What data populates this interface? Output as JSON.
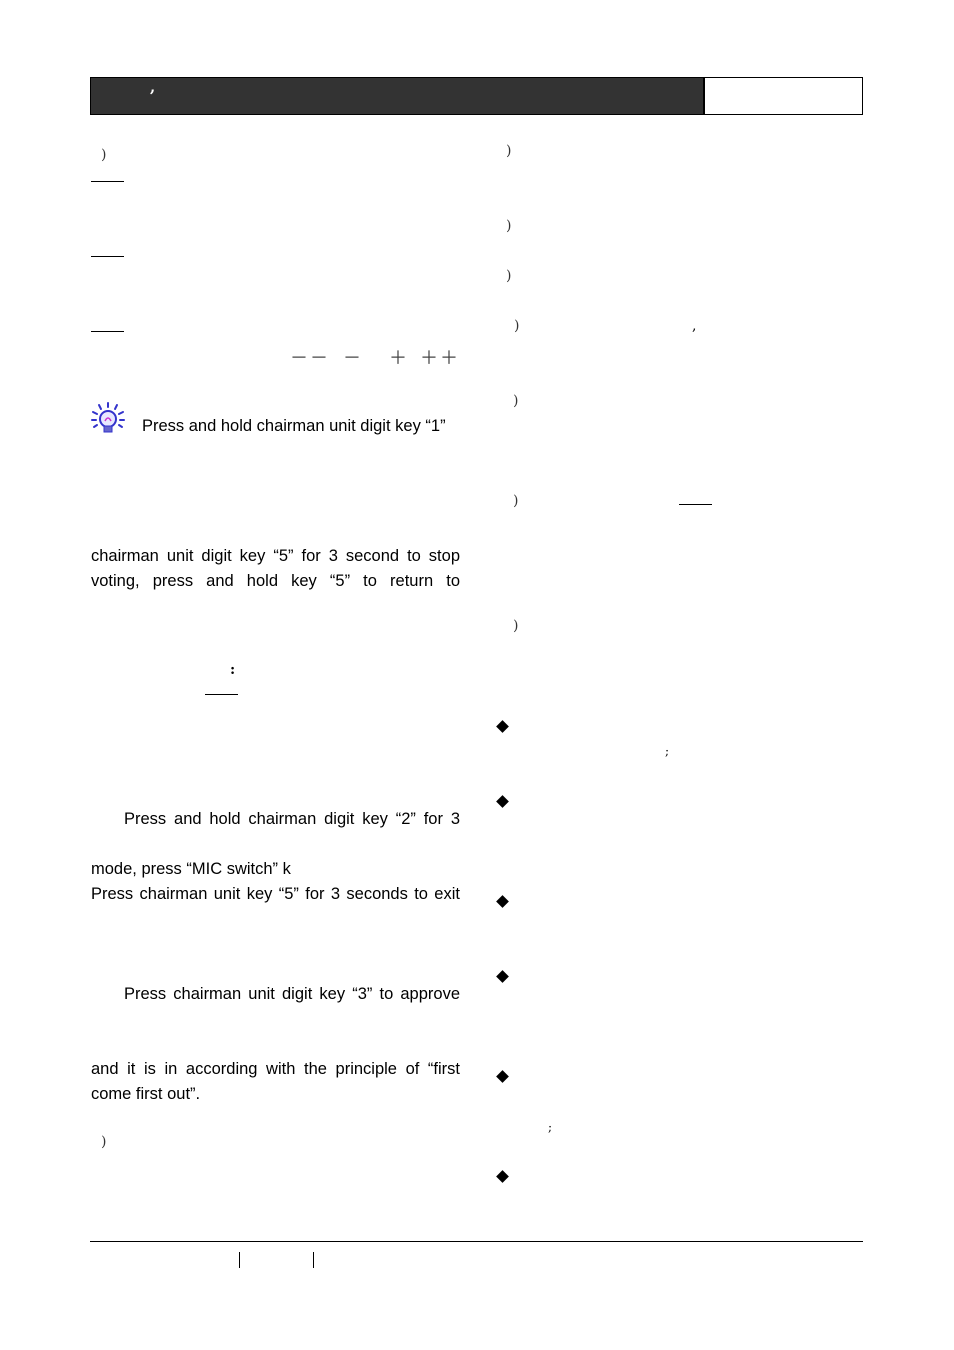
{
  "header": {
    "mark": ",",
    "box_text": ""
  },
  "left_column": {
    "paren_1": ")",
    "plus_minus_scale": [
      "－－",
      "－",
      "＋",
      "＋＋"
    ],
    "tip_text": "Press and hold chairman unit digit key “1”",
    "para_voting_line1": "chairman unit digit key “5” for 3 second to stop",
    "para_voting_line2": "voting, press and hold key “5” to return to",
    "colon_mark": ":",
    "para_mic_line1": "Press and hold chairman digit key “2” for 3",
    "para_mic_line2": "mode, press “MIC switch” k",
    "para_mic_line3": "Press chairman unit key “5” for 3 seconds to exit",
    "para_approve_line1": "Press chairman unit digit key “3” to approve",
    "para_fifo_line1": "and it is in according with the principle of “first",
    "para_fifo_line2": "come first out”.",
    "paren_2": ")"
  },
  "right_column": {
    "parens": [
      ")",
      ")",
      ")",
      ")",
      ")",
      ")",
      ")"
    ],
    "comma_mark": ",",
    "semicolon_1": ";",
    "semicolon_2": ";",
    "bullet_count": 6
  },
  "icons": {
    "tip": "lightbulb-tip-icon",
    "bullet": "diamond-bullet-icon"
  },
  "colors": {
    "header_bg": "#333333",
    "tip_icon": "#3333cc"
  }
}
